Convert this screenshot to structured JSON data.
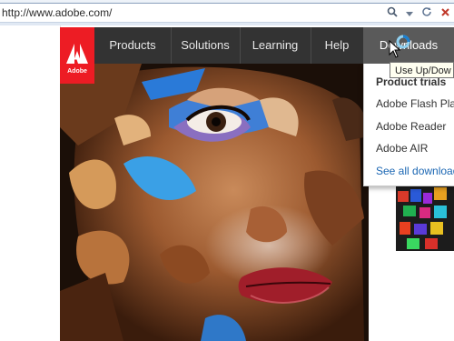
{
  "browser": {
    "url": "http://www.adobe.com/",
    "icons": [
      "search-icon",
      "dropdown-arrow-icon",
      "refresh-icon",
      "stop-icon"
    ]
  },
  "logo": {
    "text": "Adobe"
  },
  "nav": {
    "items": [
      {
        "label": "Products"
      },
      {
        "label": "Solutions"
      },
      {
        "label": "Learning"
      },
      {
        "label": "Help"
      },
      {
        "label": "Downloads"
      }
    ],
    "active": "Downloads"
  },
  "dropdown": {
    "items": [
      {
        "label": "Product trials"
      },
      {
        "label": "Adobe Flash Play"
      },
      {
        "label": "Adobe Reader"
      },
      {
        "label": "Adobe AIR"
      },
      {
        "label": "See all downloads"
      }
    ]
  },
  "tooltip": {
    "text": "Use Up/Dow"
  },
  "colors": {
    "brand_red": "#ed1c24",
    "nav_bg": "#333333",
    "link_blue": "#1a66b3"
  }
}
